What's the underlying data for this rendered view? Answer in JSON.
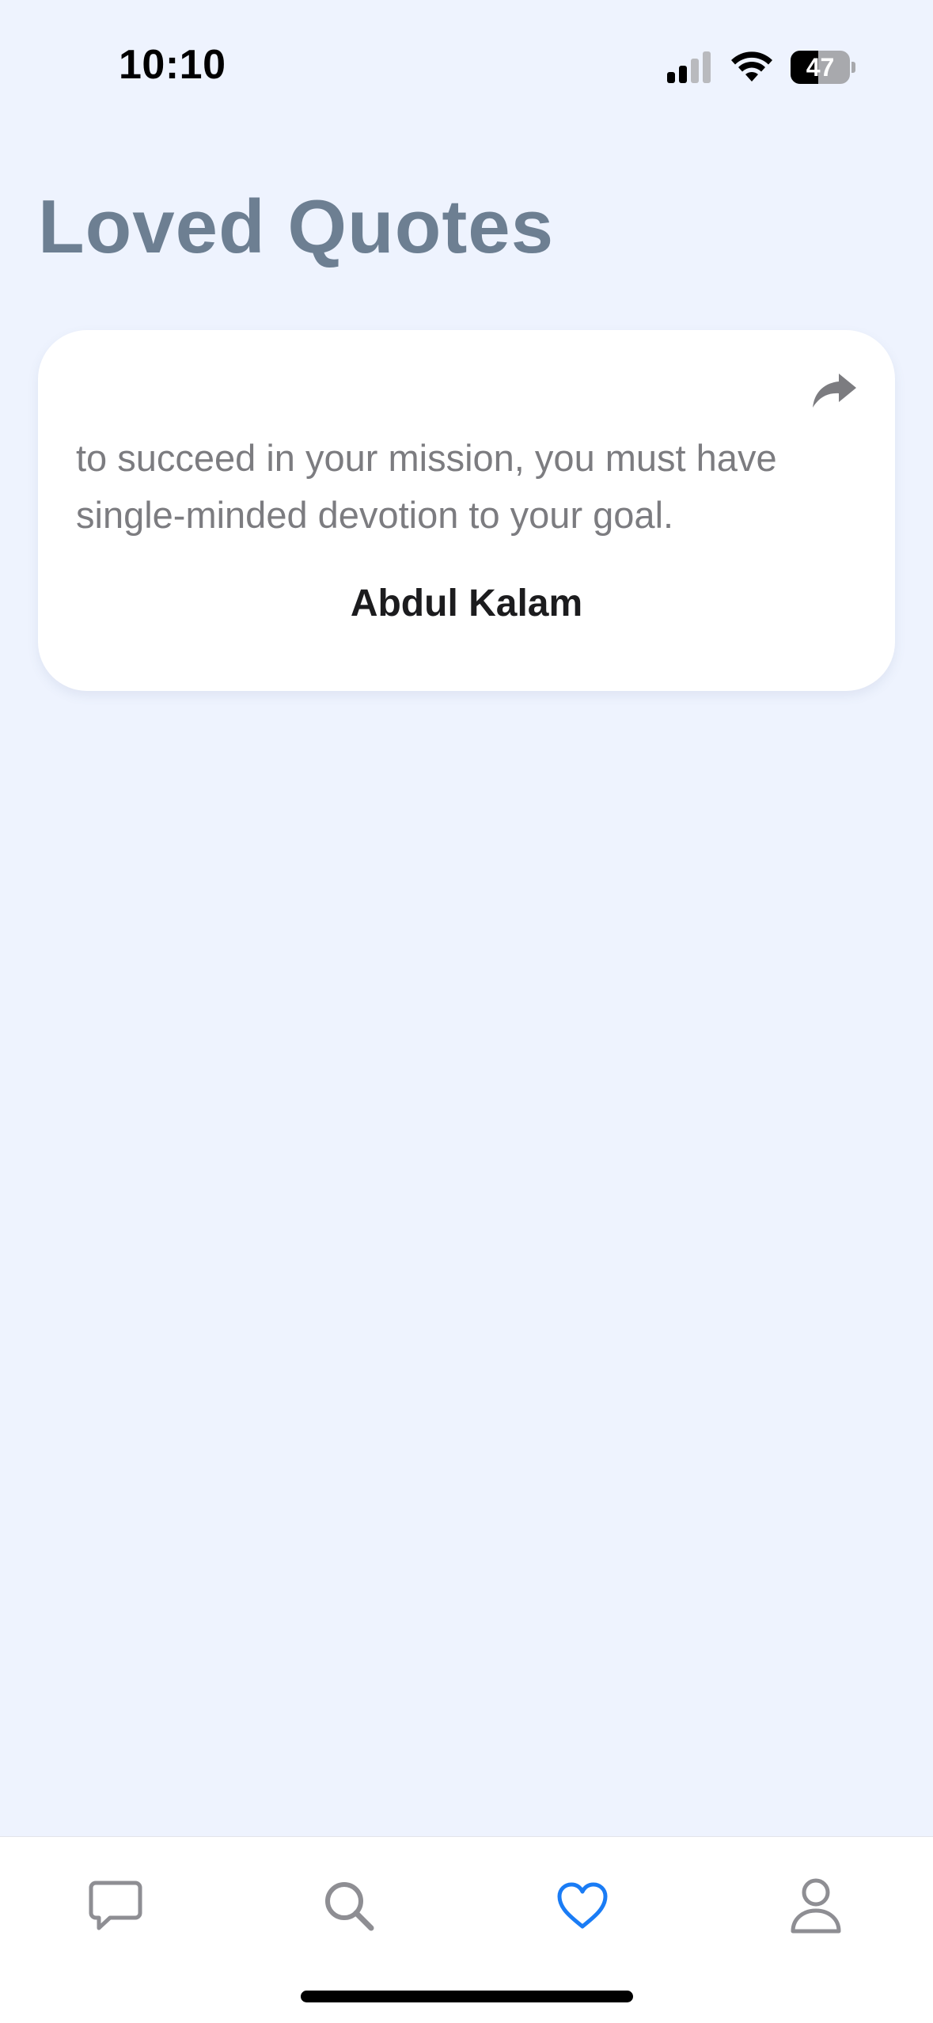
{
  "status_bar": {
    "time": "10:10",
    "battery_level": "47",
    "signal_bars_active": 2,
    "signal_bars_total": 4
  },
  "header": {
    "title": "Loved Quotes"
  },
  "quotes": [
    {
      "text": "to succeed in your mission, you must have single-minded devotion to your goal.",
      "author": "Abdul Kalam",
      "share_icon": "share-arrow-icon"
    }
  ],
  "tab_bar": {
    "tabs": [
      {
        "icon": "chat-bubble-icon",
        "active": false
      },
      {
        "icon": "search-icon",
        "active": false
      },
      {
        "icon": "heart-icon",
        "active": true
      },
      {
        "icon": "person-icon",
        "active": false
      }
    ],
    "active_color": "#1a7cf5",
    "inactive_color": "#8e8e93"
  },
  "colors": {
    "background": "#eef3fe",
    "title": "#6d7f92",
    "card": "#ffffff",
    "quote_text": "#7c7c80",
    "author_text": "#1c1c1e"
  }
}
